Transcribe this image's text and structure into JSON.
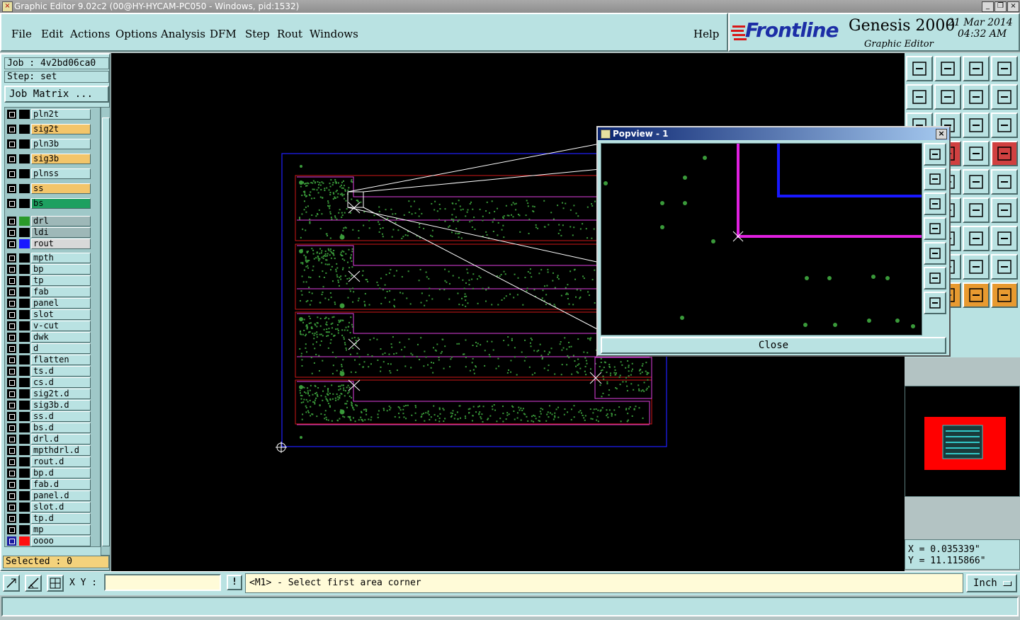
{
  "window": {
    "title": "Graphic Editor 9.02c2 (00@HY-HYCAM-PC050 - Windows, pid:1532)"
  },
  "menu": [
    "File",
    "Edit",
    "Actions",
    "Options",
    "Analysis",
    "DFM",
    "Step",
    "Rout",
    "Windows"
  ],
  "help": "Help",
  "brand": {
    "logo": "Frontline",
    "product": "Genesis 2000",
    "subtitle": "Graphic Editor",
    "date": "21 Mar 2014",
    "time": "04:32 AM"
  },
  "job": "Job : 4v2bd06ca0",
  "step": "Step: set",
  "job_matrix": "Job Matrix ...",
  "layers": [
    {
      "name": "pln2t",
      "color": "#b9e2e2",
      "swatch": null
    },
    {
      "name": "sig2t",
      "color": "#f3c56a",
      "swatch": null
    },
    {
      "name": "pln3b",
      "color": "#b9e2e2",
      "swatch": null
    },
    {
      "name": "sig3b",
      "color": "#f3c56a",
      "swatch": null
    },
    {
      "name": "plnss",
      "color": "#b9e2e2",
      "swatch": null
    },
    {
      "name": "ss",
      "color": "#f3c56a",
      "swatch": null
    },
    {
      "name": "bs",
      "color": "#1da060",
      "swatch": null
    },
    {
      "name": "drl",
      "color": "#9eb8b8",
      "swatch": "#2a9a2a"
    },
    {
      "name": "ldi",
      "color": "#9eb8b8",
      "swatch": null
    },
    {
      "name": "rout",
      "color": "#d8d8d8",
      "swatch": "#1818ff"
    },
    {
      "name": "mpth",
      "color": "#b9e2e2",
      "swatch": null
    },
    {
      "name": "bp",
      "color": "#b9e2e2",
      "swatch": null
    },
    {
      "name": "tp",
      "color": "#b9e2e2",
      "swatch": null
    },
    {
      "name": "fab",
      "color": "#b9e2e2",
      "swatch": null
    },
    {
      "name": "panel",
      "color": "#b9e2e2",
      "swatch": null
    },
    {
      "name": "slot",
      "color": "#b9e2e2",
      "swatch": null
    },
    {
      "name": "v-cut",
      "color": "#b9e2e2",
      "swatch": null
    },
    {
      "name": "dwk",
      "color": "#b9e2e2",
      "swatch": null
    },
    {
      "name": "d",
      "color": "#b9e2e2",
      "swatch": null
    },
    {
      "name": "flatten",
      "color": "#b9e2e2",
      "swatch": null
    },
    {
      "name": "ts.d",
      "color": "#b9e2e2",
      "swatch": null
    },
    {
      "name": "cs.d",
      "color": "#b9e2e2",
      "swatch": null
    },
    {
      "name": "sig2t.d",
      "color": "#b9e2e2",
      "swatch": null
    },
    {
      "name": "sig3b.d",
      "color": "#b9e2e2",
      "swatch": null
    },
    {
      "name": "ss.d",
      "color": "#b9e2e2",
      "swatch": null
    },
    {
      "name": "bs.d",
      "color": "#b9e2e2",
      "swatch": null
    },
    {
      "name": "drl.d",
      "color": "#b9e2e2",
      "swatch": null
    },
    {
      "name": "mpthdrl.d",
      "color": "#b9e2e2",
      "swatch": null
    },
    {
      "name": "rout.d",
      "color": "#b9e2e2",
      "swatch": null
    },
    {
      "name": "bp.d",
      "color": "#b9e2e2",
      "swatch": null
    },
    {
      "name": "fab.d",
      "color": "#b9e2e2",
      "swatch": null
    },
    {
      "name": "panel.d",
      "color": "#b9e2e2",
      "swatch": null
    },
    {
      "name": "slot.d",
      "color": "#b9e2e2",
      "swatch": null
    },
    {
      "name": "tp.d",
      "color": "#b9e2e2",
      "swatch": null
    },
    {
      "name": "mp",
      "color": "#b9e2e2",
      "swatch": null
    },
    {
      "name": "oooo",
      "color": "#b9e2e2",
      "swatch": "#ff1010"
    }
  ],
  "selected": "Selected : 0",
  "coords": {
    "x": "X = 0.035339\"",
    "y": "Y = 11.115866\""
  },
  "xy_label": "X Y :",
  "xy_value": "",
  "bang": "!",
  "prompt": "<M1> - Select first area corner",
  "units": "Inch",
  "popview": {
    "title": "Popview - 1",
    "close": "Close"
  },
  "colors": {
    "panel": "#b9e2e2",
    "pad": "#3a9a3a",
    "profile": "#2020ff",
    "outline": "#e040e0",
    "copper": "#d01818"
  }
}
